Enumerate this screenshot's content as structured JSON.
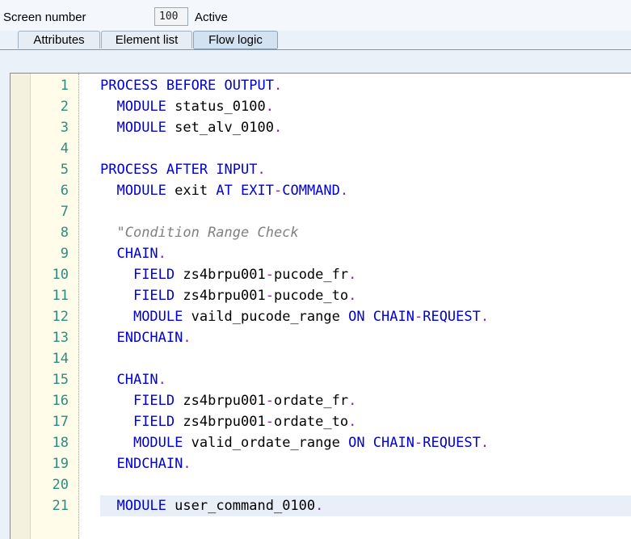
{
  "header": {
    "screen_number_label": "Screen number",
    "screen_number_value": "100",
    "status": "Active"
  },
  "tabs": [
    {
      "label": "Attributes",
      "active": false
    },
    {
      "label": "Element list",
      "active": false
    },
    {
      "label": "Flow logic",
      "active": true
    }
  ],
  "colors": {
    "keyword": "#0000d8",
    "punctuation": "#7a2e9c",
    "comment": "#808080",
    "line_number": "#2d8c82"
  },
  "editor": {
    "current_line": 21,
    "lines": [
      {
        "num": "1",
        "tokens": [
          {
            "t": "PROCESS BEFORE OUTPUT",
            "c": "kw"
          },
          {
            "t": ".",
            "c": "pt"
          }
        ]
      },
      {
        "num": "2",
        "tokens": [
          {
            "t": "  "
          },
          {
            "t": "MODULE",
            "c": "kw"
          },
          {
            "t": " status_0100"
          },
          {
            "t": ".",
            "c": "pt"
          }
        ]
      },
      {
        "num": "3",
        "tokens": [
          {
            "t": "  "
          },
          {
            "t": "MODULE",
            "c": "kw"
          },
          {
            "t": " set_alv_0100"
          },
          {
            "t": ".",
            "c": "pt"
          }
        ]
      },
      {
        "num": "4",
        "tokens": []
      },
      {
        "num": "5",
        "tokens": [
          {
            "t": "PROCESS AFTER INPUT",
            "c": "kw"
          },
          {
            "t": ".",
            "c": "pt"
          }
        ]
      },
      {
        "num": "6",
        "tokens": [
          {
            "t": "  "
          },
          {
            "t": "MODULE",
            "c": "kw"
          },
          {
            "t": " exit "
          },
          {
            "t": "AT EXIT",
            "c": "kw"
          },
          {
            "t": "-",
            "c": "pt"
          },
          {
            "t": "COMMAND",
            "c": "kw"
          },
          {
            "t": ".",
            "c": "pt"
          }
        ]
      },
      {
        "num": "7",
        "tokens": []
      },
      {
        "num": "8",
        "tokens": [
          {
            "t": "  "
          },
          {
            "t": "\"Condition Range Check",
            "c": "cm"
          }
        ]
      },
      {
        "num": "9",
        "tokens": [
          {
            "t": "  "
          },
          {
            "t": "CHAIN",
            "c": "kw"
          },
          {
            "t": ".",
            "c": "pt"
          }
        ]
      },
      {
        "num": "10",
        "tokens": [
          {
            "t": "    "
          },
          {
            "t": "FIELD",
            "c": "kw"
          },
          {
            "t": " zs4brpu001"
          },
          {
            "t": "-",
            "c": "pt"
          },
          {
            "t": "pucode_fr"
          },
          {
            "t": ".",
            "c": "pt"
          }
        ]
      },
      {
        "num": "11",
        "tokens": [
          {
            "t": "    "
          },
          {
            "t": "FIELD",
            "c": "kw"
          },
          {
            "t": " zs4brpu001"
          },
          {
            "t": "-",
            "c": "pt"
          },
          {
            "t": "pucode_to"
          },
          {
            "t": ".",
            "c": "pt"
          }
        ]
      },
      {
        "num": "12",
        "tokens": [
          {
            "t": "    "
          },
          {
            "t": "MODULE",
            "c": "kw"
          },
          {
            "t": " vaild_pucode_range "
          },
          {
            "t": "ON CHAIN",
            "c": "kw"
          },
          {
            "t": "-",
            "c": "pt"
          },
          {
            "t": "REQUEST",
            "c": "kw"
          },
          {
            "t": ".",
            "c": "pt"
          }
        ]
      },
      {
        "num": "13",
        "tokens": [
          {
            "t": "  "
          },
          {
            "t": "ENDCHAIN",
            "c": "kw"
          },
          {
            "t": ".",
            "c": "pt"
          }
        ]
      },
      {
        "num": "14",
        "tokens": []
      },
      {
        "num": "15",
        "tokens": [
          {
            "t": "  "
          },
          {
            "t": "CHAIN",
            "c": "kw"
          },
          {
            "t": ".",
            "c": "pt"
          }
        ]
      },
      {
        "num": "16",
        "tokens": [
          {
            "t": "    "
          },
          {
            "t": "FIELD",
            "c": "kw"
          },
          {
            "t": " zs4brpu001"
          },
          {
            "t": "-",
            "c": "pt"
          },
          {
            "t": "ordate_fr"
          },
          {
            "t": ".",
            "c": "pt"
          }
        ]
      },
      {
        "num": "17",
        "tokens": [
          {
            "t": "    "
          },
          {
            "t": "FIELD",
            "c": "kw"
          },
          {
            "t": " zs4brpu001"
          },
          {
            "t": "-",
            "c": "pt"
          },
          {
            "t": "ordate_to"
          },
          {
            "t": ".",
            "c": "pt"
          }
        ]
      },
      {
        "num": "18",
        "tokens": [
          {
            "t": "    "
          },
          {
            "t": "MODULE",
            "c": "kw"
          },
          {
            "t": " valid_ordate_range "
          },
          {
            "t": "ON CHAIN",
            "c": "kw"
          },
          {
            "t": "-",
            "c": "pt"
          },
          {
            "t": "REQUEST",
            "c": "kw"
          },
          {
            "t": ".",
            "c": "pt"
          }
        ]
      },
      {
        "num": "19",
        "tokens": [
          {
            "t": "  "
          },
          {
            "t": "ENDCHAIN",
            "c": "kw"
          },
          {
            "t": ".",
            "c": "pt"
          }
        ]
      },
      {
        "num": "20",
        "tokens": []
      },
      {
        "num": "21",
        "tokens": [
          {
            "t": "  "
          },
          {
            "t": "MODULE",
            "c": "kw"
          },
          {
            "t": " user_command_0100"
          },
          {
            "t": ".",
            "c": "pt"
          }
        ]
      }
    ]
  }
}
